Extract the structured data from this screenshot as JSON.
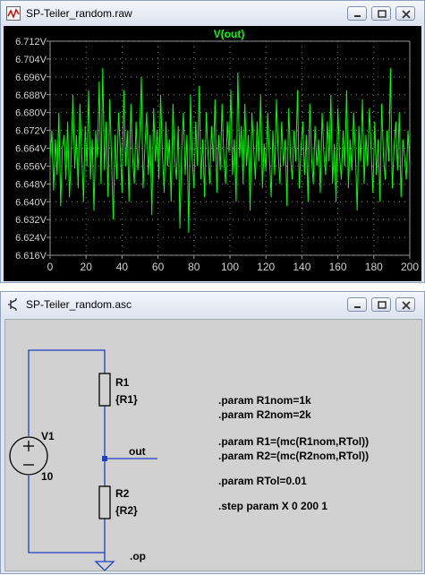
{
  "plot_window": {
    "title": "SP-Teiler_random.raw",
    "icon": "waveform-icon",
    "buttons": [
      "minimize",
      "restore",
      "close"
    ]
  },
  "chart_data": {
    "type": "line",
    "title": "V(out)",
    "xlabel": "",
    "ylabel": "",
    "xlim": [
      0,
      200
    ],
    "ylim": [
      6.616,
      6.712
    ],
    "x_ticks": [
      "0",
      "20",
      "40",
      "60",
      "80",
      "100",
      "120",
      "140",
      "160",
      "180",
      "200"
    ],
    "y_ticks": [
      "6.712V",
      "6.704V",
      "6.696V",
      "6.688V",
      "6.680V",
      "6.672V",
      "6.664V",
      "6.656V",
      "6.648V",
      "6.640V",
      "6.632V",
      "6.624V",
      "6.616V"
    ],
    "grid": true,
    "background": "#000000",
    "series": [
      {
        "name": "V(out)",
        "color": "#00ff00",
        "values": [
          6.66,
          6.672,
          6.645,
          6.668,
          6.652,
          6.68,
          6.638,
          6.664,
          6.67,
          6.65,
          6.676,
          6.642,
          6.66,
          6.688,
          6.655,
          6.67,
          6.646,
          6.684,
          6.662,
          6.64,
          6.674,
          6.656,
          6.69,
          6.65,
          6.668,
          6.636,
          6.672,
          6.66,
          6.694,
          6.648,
          6.7,
          6.654,
          6.676,
          6.642,
          6.686,
          6.66,
          6.632,
          6.67,
          6.65,
          6.68,
          6.664,
          6.644,
          6.69,
          6.656,
          6.672,
          6.64,
          6.684,
          6.66,
          6.648,
          6.676,
          6.654,
          6.668,
          6.696,
          6.646,
          6.664,
          6.68,
          6.652,
          6.67,
          6.634,
          6.682,
          6.658,
          6.672,
          6.65,
          6.688,
          6.662,
          6.644,
          6.676,
          6.656,
          6.668,
          6.64,
          6.684,
          6.66,
          6.65,
          6.674,
          6.628,
          6.664,
          6.68,
          6.652,
          6.67,
          6.626,
          6.688,
          6.66,
          6.646,
          6.676,
          6.656,
          6.692,
          6.65,
          6.668,
          6.642,
          6.68,
          6.662,
          6.648,
          6.674,
          6.658,
          6.686,
          6.644,
          6.67,
          6.654,
          6.684,
          6.66,
          6.648,
          6.676,
          6.662,
          6.69,
          6.652,
          6.668,
          6.64,
          6.698,
          6.66,
          6.674,
          6.648,
          6.684,
          6.656,
          6.67,
          6.636,
          6.68,
          6.664,
          6.65,
          6.676,
          6.658,
          6.688,
          6.646,
          6.666,
          6.654,
          6.68,
          6.66,
          6.642,
          6.672,
          6.652,
          6.686,
          6.662,
          6.648,
          6.676,
          6.656,
          6.668,
          6.638,
          6.682,
          6.66,
          6.65,
          6.672,
          6.658,
          6.69,
          6.646,
          6.664,
          6.676,
          6.652,
          6.67,
          6.64,
          6.684,
          6.66,
          6.648,
          6.674,
          6.656,
          6.668,
          6.644,
          6.68,
          6.662,
          6.652,
          6.676,
          6.658,
          6.688,
          6.648,
          6.666,
          6.64,
          6.682,
          6.66,
          6.65,
          6.672,
          6.656,
          6.69,
          6.646,
          6.668,
          6.654,
          6.68,
          6.662,
          6.636,
          6.674,
          6.658,
          6.686,
          6.648,
          6.67,
          6.656,
          6.682,
          6.662,
          6.644,
          6.676,
          6.652,
          6.668,
          6.64,
          6.684,
          6.66,
          6.65,
          6.672,
          6.658,
          6.7,
          6.646,
          6.664,
          6.676,
          6.654,
          6.68,
          6.642,
          6.668,
          6.66,
          6.65,
          6.672,
          6.656
        ]
      }
    ]
  },
  "schematic_window": {
    "title": "SP-Teiler_random.asc",
    "icon": "schematic-icon",
    "buttons": [
      "minimize",
      "restore",
      "close"
    ],
    "components": {
      "v1_name": "V1",
      "v1_value": "10",
      "r1_name": "R1",
      "r1_value": "{R1}",
      "r2_name": "R2",
      "r2_value": "{R2}",
      "net_label": "out",
      "op_directive": ".op"
    },
    "directives": [
      ".param R1nom=1k",
      ".param R2nom=2k",
      ".param R1=(mc(R1nom,RTol))",
      ".param R2=(mc(R2nom,RTol))",
      ".param RTol=0.01",
      ".step param X 0 200 1"
    ]
  }
}
